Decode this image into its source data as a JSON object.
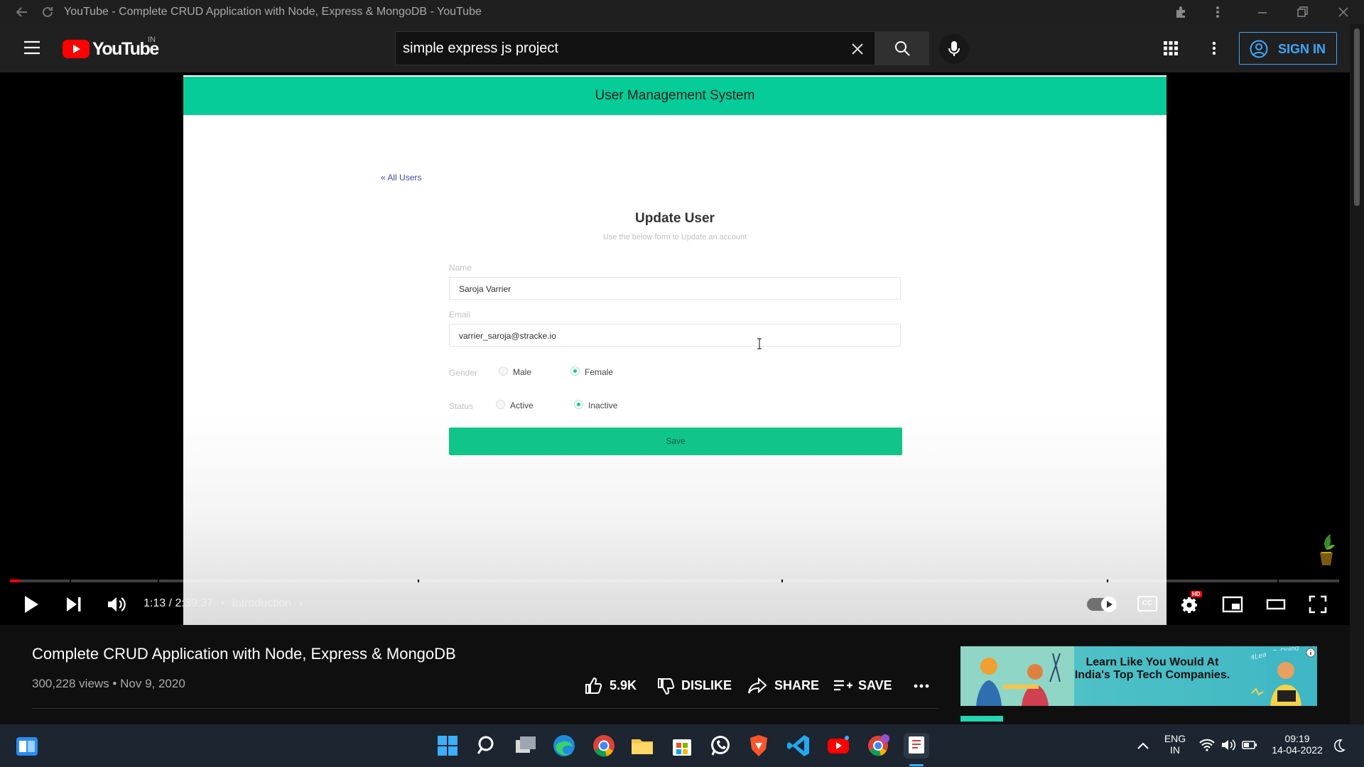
{
  "browser": {
    "window_title": "YouTube - Complete CRUD Application with Node, Express & MongoDB - YouTube"
  },
  "header": {
    "logo_text": "YouTube",
    "region": "IN",
    "search_value": "simple express js project",
    "sign_in_label": "SIGN IN"
  },
  "video_content": {
    "app_title": "User Management System",
    "back_link": "All Users",
    "form_title": "Update User",
    "form_subtitle": "Use the below form to Update an account",
    "name_label": "Name",
    "name_value": "Saroja Varrier",
    "email_label": "Email",
    "email_value": "varrier_saroja@stracke.io",
    "gender_label": "Gender",
    "gender_options": [
      "Male",
      "Female"
    ],
    "gender_selected": "Female",
    "status_label": "Status",
    "status_options": [
      "Active",
      "Inactive"
    ],
    "status_selected": "Inactive",
    "save_label": "Save"
  },
  "player": {
    "time_current": "1:13",
    "time_total": "2:39:37",
    "chapter": "Introduction",
    "progress_fraction": 0.0076,
    "hd_badge": "HD",
    "cc_label": "CC"
  },
  "video_info": {
    "title": "Complete CRUD Application with Node, Express & MongoDB",
    "views": "300,228 views",
    "date": "Nov 9, 2020",
    "likes": "5.9K",
    "dislike_label": "DISLIKE",
    "share_label": "SHARE",
    "save_label": "SAVE"
  },
  "ad": {
    "headline": "Learn Like You Would At India's Top Tech Companies.",
    "tag": "#LearnByDoing"
  },
  "taskbar": {
    "lang_line1": "ENG",
    "lang_line2": "IN",
    "time": "09:19",
    "date": "14-04-2022"
  },
  "colors": {
    "app_header_green": "#05cc98",
    "save_button_green": "#10c48a",
    "youtube_red": "#ff0000",
    "sign_in_blue": "#3ea6ff"
  }
}
